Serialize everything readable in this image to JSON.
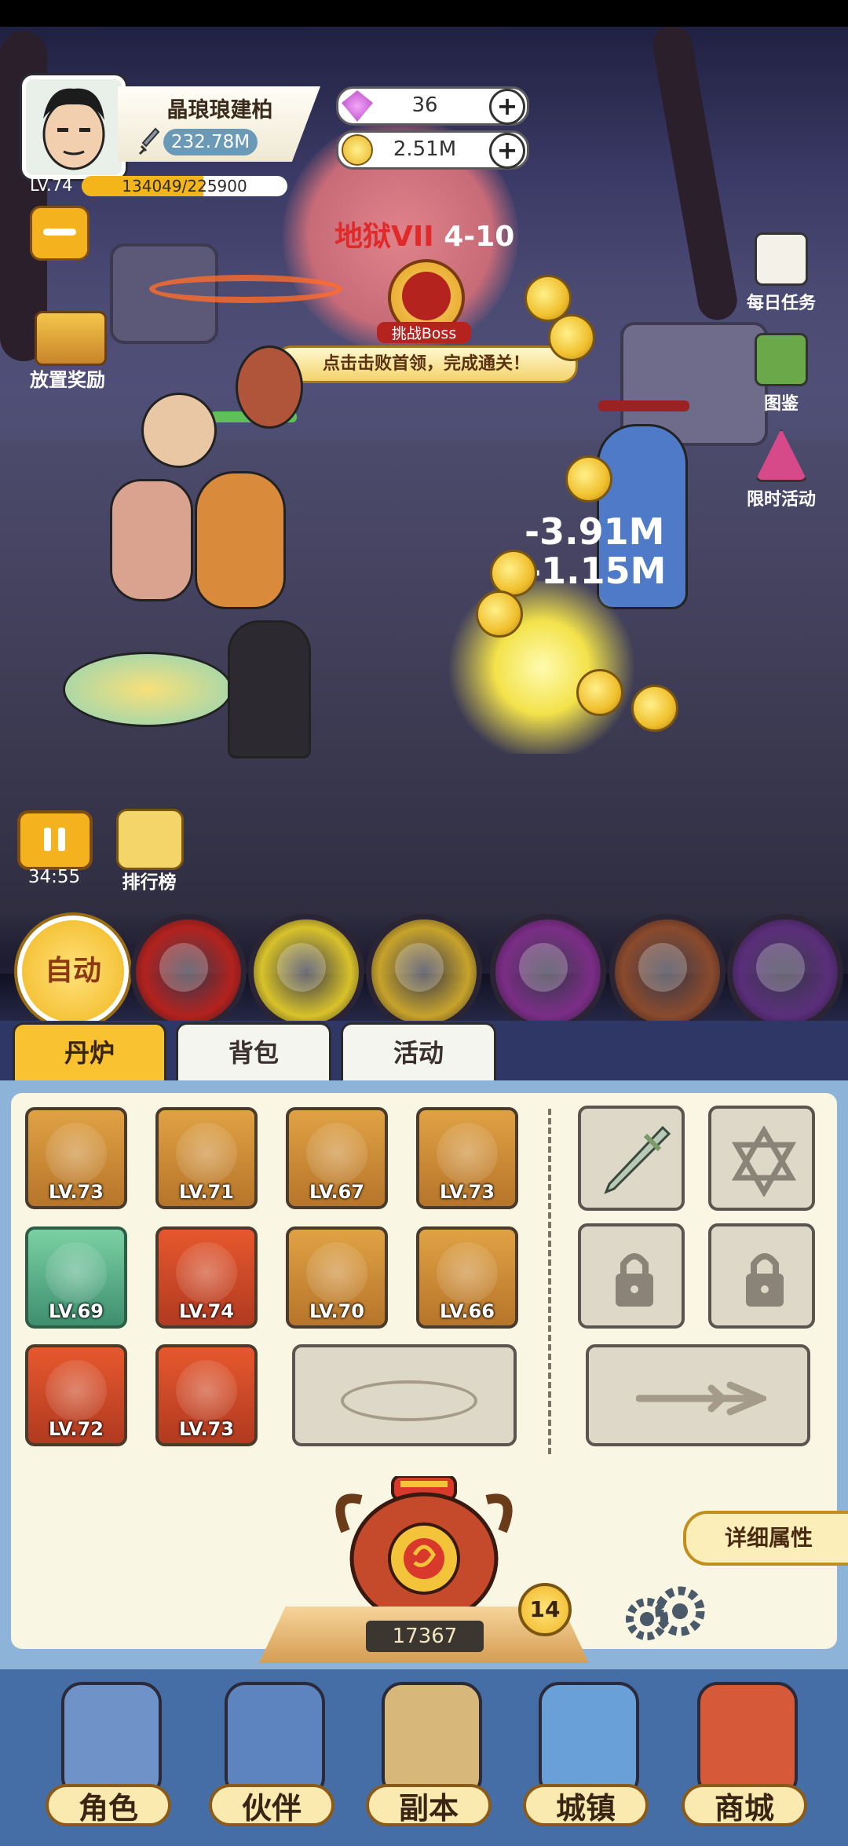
{
  "player": {
    "name": "晶琅琅建柏",
    "power": "232.78M",
    "level": "LV.74",
    "exp_text": "134049/225900",
    "exp_fraction": 0.593
  },
  "currency": {
    "gems": "36",
    "gold": "2.51M"
  },
  "stage": {
    "realm": "地狱VII",
    "number": "4-10",
    "boss_label": "挑战Boss",
    "hint": "点击击败首领，完成通关！"
  },
  "left_menu": {
    "idle_reward": "放置奖励"
  },
  "right_menu": [
    {
      "label": "每日任务",
      "icon": "task-list-icon"
    },
    {
      "label": "图鉴",
      "icon": "book-icon"
    },
    {
      "label": "限时活动",
      "icon": "party-hat-icon"
    }
  ],
  "damage_texts": [
    "-3.91M",
    "-1.15M"
  ],
  "battle": {
    "timer": "34:55",
    "rank_label": "排行榜"
  },
  "skills": {
    "auto_label": "自动",
    "items": [
      {
        "icon": "red-slash-skill-icon",
        "color": "#b3221e"
      },
      {
        "icon": "lightning-skill-icon",
        "color": "#d8c22a"
      },
      {
        "icon": "sword-rain-skill-icon",
        "color": "#c7a32b"
      },
      {
        "icon": "purple-vortex-skill-icon",
        "color": "#7b2d86"
      },
      {
        "icon": "tornado-skill-icon",
        "color": "#8a4a2c"
      },
      {
        "icon": "purple-orb-skill-icon",
        "color": "#5a2e7a"
      }
    ]
  },
  "tabs": [
    {
      "label": "丹炉",
      "active": true
    },
    {
      "label": "背包",
      "active": false
    },
    {
      "label": "活动",
      "active": false
    }
  ],
  "equipment": [
    {
      "level": "LV.73",
      "rarity": "gold",
      "icon": "staff-icon"
    },
    {
      "level": "LV.71",
      "rarity": "gold",
      "icon": "helmet-icon"
    },
    {
      "level": "LV.67",
      "rarity": "gold",
      "icon": "robe-icon"
    },
    {
      "level": "LV.73",
      "rarity": "gold",
      "icon": "dragon-orb-icon"
    },
    {
      "level": "LV.69",
      "rarity": "green",
      "icon": "lotus-icon"
    },
    {
      "level": "LV.74",
      "rarity": "red",
      "icon": "bagua-icon"
    },
    {
      "level": "LV.70",
      "rarity": "gold",
      "icon": "shoulder-armor-icon"
    },
    {
      "level": "LV.66",
      "rarity": "gold",
      "icon": "golden-beast-icon"
    },
    {
      "level": "LV.72",
      "rarity": "red",
      "icon": "belt-icon"
    },
    {
      "level": "LV.73",
      "rarity": "red",
      "icon": "boots-icon"
    }
  ],
  "side_slots": [
    {
      "icon": "jade-sword-icon",
      "locked": false
    },
    {
      "icon": "hexagram-icon",
      "locked": false
    },
    {
      "icon": "lock-icon",
      "locked": true
    },
    {
      "icon": "lock-icon",
      "locked": true
    }
  ],
  "furnace": {
    "count": "17367",
    "level": "14",
    "detail_label": "详细属性"
  },
  "nav": [
    {
      "label": "角色",
      "icon": "character-icon"
    },
    {
      "label": "伙伴",
      "icon": "partner-icon"
    },
    {
      "label": "副本",
      "icon": "scroll-icon"
    },
    {
      "label": "城镇",
      "icon": "town-icon"
    },
    {
      "label": "商城",
      "icon": "shop-icon"
    }
  ],
  "colors": {
    "accent_gold": "#f4b21f",
    "panel_bg": "#faf6e4",
    "nav_bg": "#456ea6",
    "stage_red": "#e02a2a"
  }
}
